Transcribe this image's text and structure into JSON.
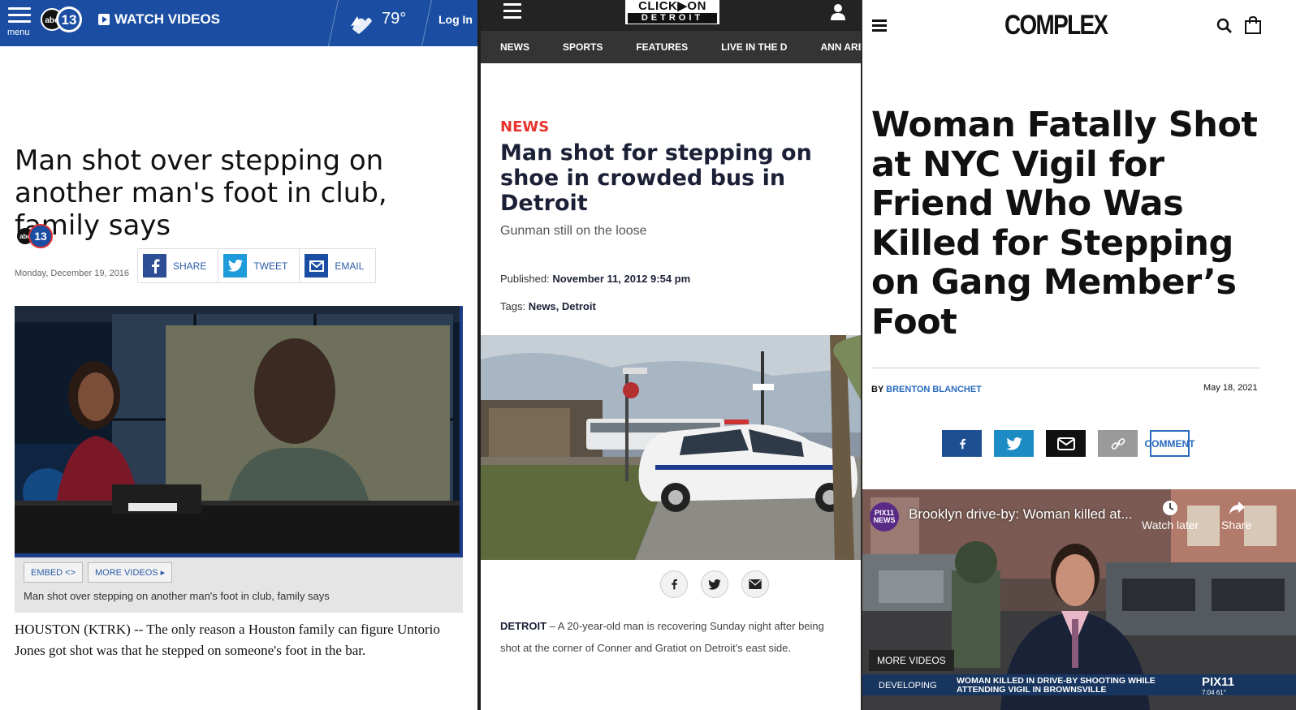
{
  "panel1": {
    "menu_label": "menu",
    "logo_text": "abc13",
    "watch_videos": "WATCH VIDEOS",
    "temperature": "79°",
    "login": "Log In",
    "headline": "Man shot over stepping on another man's foot in club, family says",
    "date": "Monday, December 19, 2016",
    "share": {
      "facebook": "SHARE",
      "twitter": "TWEET",
      "email": "EMAIL"
    },
    "video_buttons": {
      "embed": "EMBED <>",
      "more": "MORE VIDEOS ▸"
    },
    "video_caption": "Man shot over stepping on another man's foot in club, family says",
    "body": "HOUSTON (KTRK) -- The only reason a Houston family can figure Untorio Jones got shot was that he stepped on someone's foot in the bar.",
    "colors": {
      "brand": "#1b4ea3",
      "link": "#2b5aa8"
    }
  },
  "panel2": {
    "logo_top": "CLICK▶ON",
    "logo_bottom": "DETROIT",
    "nav": [
      "NEWS",
      "SPORTS",
      "FEATURES",
      "LIVE IN THE D",
      "ANN ARB"
    ],
    "kicker": "NEWS",
    "headline": "Man shot for stepping on shoe in crowded bus in Detroit",
    "subhead": "Gunman still on the loose",
    "published_label": "Published:",
    "published_value": "November 11, 2012 9:54 pm",
    "tags_label": "Tags:",
    "tags_value": "News, Detroit",
    "body_lead": "DETROIT",
    "body": " – A 20-year-old man is recovering Sunday night after being shot at the corner of Conner and Gratiot on Detroit's east side.",
    "colors": {
      "kicker": "#e8332e",
      "headline": "#1b2036"
    }
  },
  "panel3": {
    "logo": "COMPLEX",
    "headline": "Woman Fatally Shot at NYC Vigil for Friend Who Was Killed for Stepping on Gang Member’s Foot",
    "by_label": "BY",
    "author": "BRENTON BLANCHET",
    "date": "May 18, 2021",
    "comment": "COMMENT",
    "video": {
      "channel": "PIX11 NEWS",
      "title": "Brooklyn drive-by: Woman killed at...",
      "watch_later": "Watch later",
      "share": "Share",
      "more_videos": "MORE VIDEOS",
      "chyron_tag": "DEVELOPING",
      "chyron_text": "WOMAN KILLED IN DRIVE-BY SHOOTING WHILE ATTENDING VIGIL IN BROWNSVILLE",
      "chyron_brand": "PIX11",
      "chyron_time": "7:04   61°"
    },
    "colors": {
      "facebook": "#1d4f92",
      "twitter": "#1d8bc4",
      "link": "#2a6bbf"
    }
  }
}
